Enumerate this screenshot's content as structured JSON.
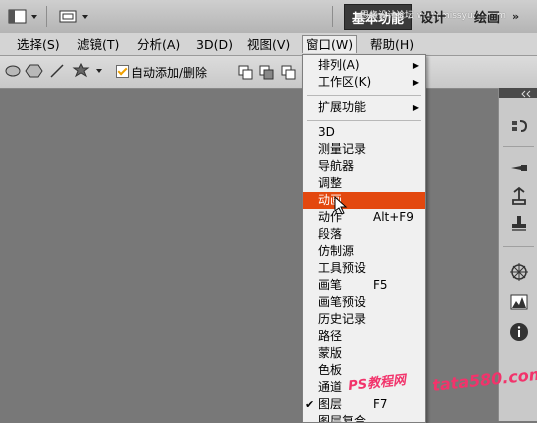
{
  "workspace": {
    "active": "基本功能",
    "design": "设计",
    "paint": "绘画",
    "more": "»",
    "watermark": "思缘设计论坛 www.missyuan.com"
  },
  "menubar": [
    {
      "label": "选择(S)"
    },
    {
      "label": "滤镜(T)"
    },
    {
      "label": "分析(A)"
    },
    {
      "label": "3D(D)"
    },
    {
      "label": "视图(V)"
    },
    {
      "label": "窗口(W)"
    },
    {
      "label": "帮助(H)"
    }
  ],
  "options": {
    "auto_add_delete": "自动添加/删除",
    "checked": true
  },
  "window_menu": [
    {
      "label": "排列(A)",
      "submenu": true
    },
    {
      "label": "工作区(K)",
      "submenu": true
    },
    {
      "label": "扩展功能",
      "submenu": true
    },
    {
      "label": "3D"
    },
    {
      "label": "测量记录"
    },
    {
      "label": "导航器"
    },
    {
      "label": "调整"
    },
    {
      "label": "动画",
      "highlighted": true
    },
    {
      "label": "动作",
      "shortcut": "Alt+F9"
    },
    {
      "label": "段落"
    },
    {
      "label": "仿制源"
    },
    {
      "label": "工具预设"
    },
    {
      "label": "画笔",
      "shortcut": "F5"
    },
    {
      "label": "画笔预设"
    },
    {
      "label": "历史记录"
    },
    {
      "label": "路径"
    },
    {
      "label": "蒙版"
    },
    {
      "label": "色板"
    },
    {
      "label": "通道"
    },
    {
      "label": "图层",
      "shortcut": "F7",
      "checked": true
    },
    {
      "label": "图层复合"
    }
  ],
  "watermark_bottom": {
    "left": "PS教程网",
    "right": "tata580.com"
  },
  "colors": {
    "highlight": "#e3480f",
    "watermark": "#f2336b"
  }
}
